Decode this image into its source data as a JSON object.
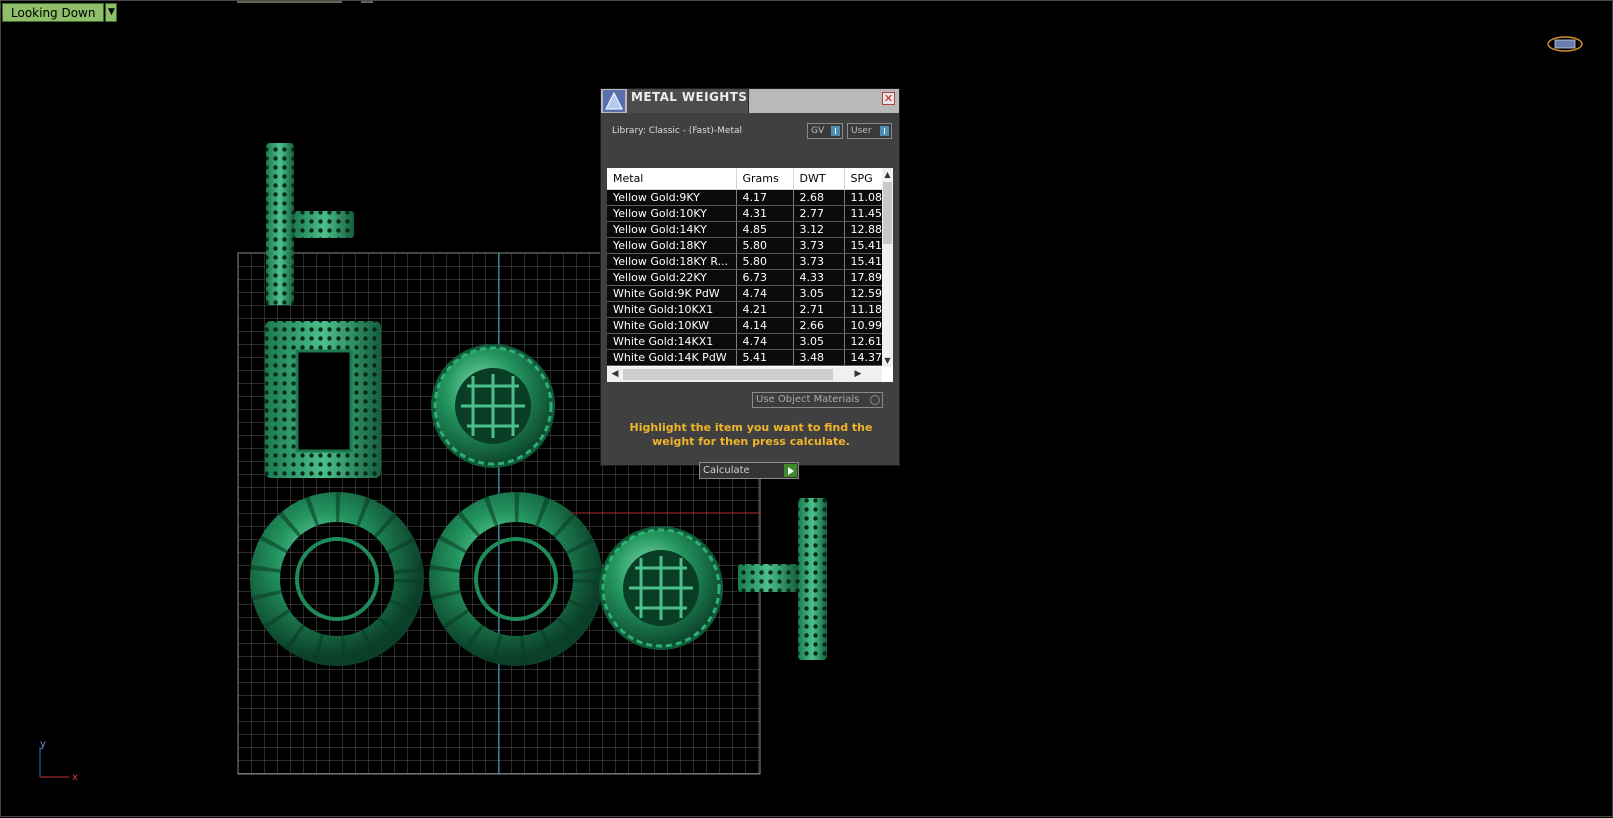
{
  "viewport": {
    "view_menu_label": "Looking Down",
    "axis_labels": {
      "y": "y",
      "x": "x"
    }
  },
  "dialog": {
    "title": "METAL WEIGHTS",
    "library_label": "Library: Classic - (Fast)-Metal",
    "toggle_gv": "GV",
    "toggle_user": "User",
    "columns": [
      "Metal",
      "Grams",
      "DWT",
      "SPG"
    ],
    "rows": [
      [
        "Yellow Gold:9KY",
        "4.17",
        "2.68",
        "11.08"
      ],
      [
        "Yellow Gold:10KY",
        "4.31",
        "2.77",
        "11.45"
      ],
      [
        "Yellow Gold:14KY",
        "4.85",
        "3.12",
        "12.88"
      ],
      [
        "Yellow Gold:18KY",
        "5.80",
        "3.73",
        "15.41"
      ],
      [
        "Yellow Gold:18KY R...",
        "5.80",
        "3.73",
        "15.41"
      ],
      [
        "Yellow Gold:22KY",
        "6.73",
        "4.33",
        "17.89"
      ],
      [
        "White Gold:9K PdW",
        "4.74",
        "3.05",
        "12.59"
      ],
      [
        "White Gold:10KX1",
        "4.21",
        "2.71",
        "11.18"
      ],
      [
        "White Gold:10KW",
        "4.14",
        "2.66",
        "10.99"
      ],
      [
        "White Gold:14KX1",
        "4.74",
        "3.05",
        "12.61"
      ],
      [
        "White Gold:14K PdW",
        "5.41",
        "3.48",
        "14.37"
      ]
    ],
    "use_object_materials": "Use Object Materials",
    "hint": "Highlight the item you want to find the weight for then press calculate.",
    "calculate_label": "Calculate"
  },
  "colors": {
    "model_green": "#1f8a5a",
    "hint_text": "#f0b52a",
    "grid_line": "#7a7a7a"
  }
}
